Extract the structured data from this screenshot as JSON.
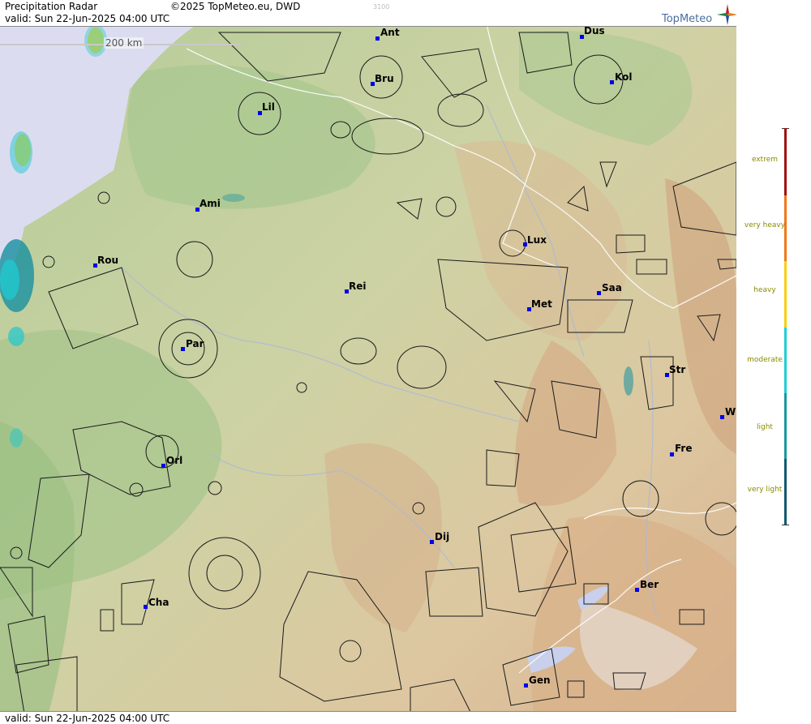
{
  "header": {
    "title": "Precipitation Radar",
    "copyright": "©2025 TopMeteo.eu, DWD",
    "valid": "valid:  Sun  22-Jun-2025 04:00 UTC",
    "faint_code": "3100"
  },
  "footer": {
    "valid": "valid:  Sun  22-Jun-2025 04:00 UTC"
  },
  "logo": {
    "text": "TopMeteo",
    "icon": "compass-star-icon"
  },
  "scale": {
    "label": "200 km"
  },
  "cities": [
    {
      "name": "Ant"
    },
    {
      "name": "Dus"
    },
    {
      "name": "Bru"
    },
    {
      "name": "Kol"
    },
    {
      "name": "Lil"
    },
    {
      "name": "Ami"
    },
    {
      "name": "Lux"
    },
    {
      "name": "Rou"
    },
    {
      "name": "Rei"
    },
    {
      "name": "Saa"
    },
    {
      "name": "Met"
    },
    {
      "name": "Par"
    },
    {
      "name": "Str"
    },
    {
      "name": "W"
    },
    {
      "name": "Orl"
    },
    {
      "name": "Fre"
    },
    {
      "name": "Dij"
    },
    {
      "name": "Ber"
    },
    {
      "name": "Cha"
    },
    {
      "name": "Gen"
    }
  ],
  "legend": {
    "items": [
      {
        "label": "extrem",
        "color": "#a01010"
      },
      {
        "label": "very heavy",
        "color": "#f07818"
      },
      {
        "label": "heavy",
        "color": "#f8d010"
      },
      {
        "label": "moderate",
        "color": "#20d0d8"
      },
      {
        "label": "light",
        "color": "#1898a0"
      },
      {
        "label": "very light",
        "color": "#105870"
      }
    ]
  },
  "colors": {
    "sea": "#dcdcf0",
    "lowland": "#a8c890",
    "upland": "#e0d0a8",
    "mountain": "#d8b088",
    "city_marker": "#0000e6"
  }
}
